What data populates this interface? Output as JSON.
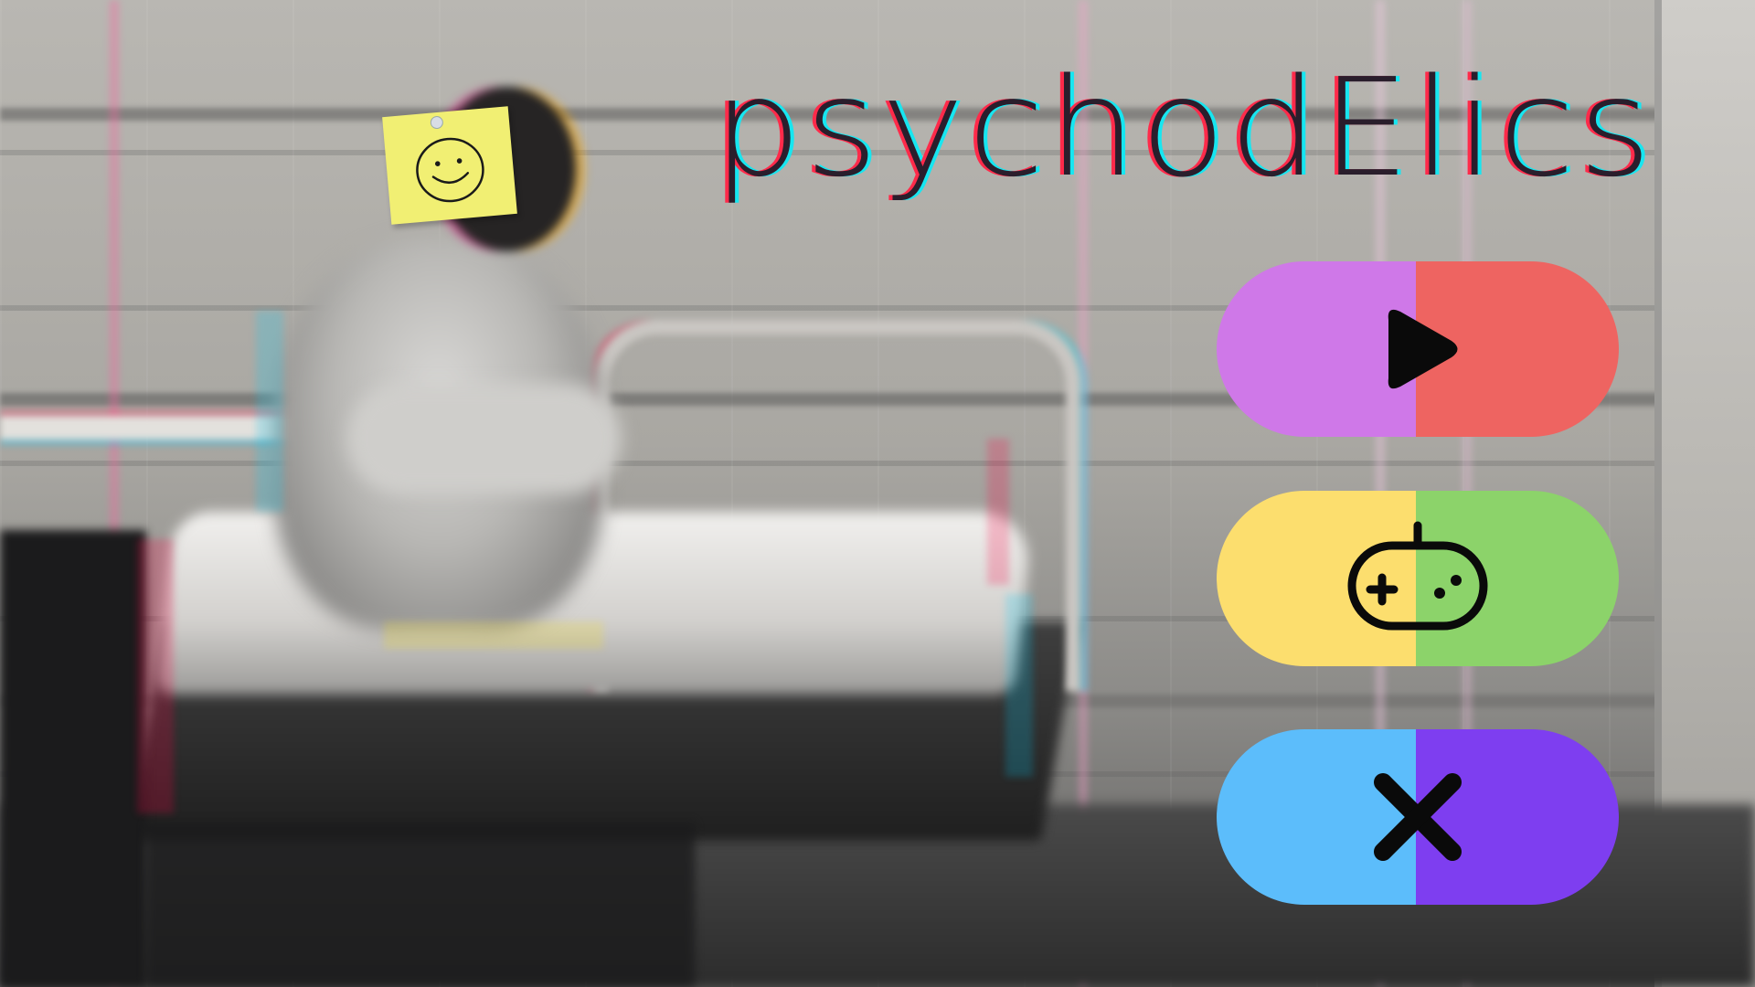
{
  "title": "psychodElics",
  "menu": {
    "play": {
      "icon": "play-icon",
      "colors": {
        "left": "#cf78e8",
        "right": "#ee6461"
      }
    },
    "games": {
      "icon": "gamepad-icon",
      "colors": {
        "left": "#fcde6e",
        "right": "#8cd36a"
      }
    },
    "quit": {
      "icon": "close-icon",
      "colors": {
        "left": "#5cbdfb",
        "right": "#7e3ef0"
      }
    }
  },
  "sticky_note": {
    "icon": "smiley-icon",
    "color": "#f1ef73"
  }
}
